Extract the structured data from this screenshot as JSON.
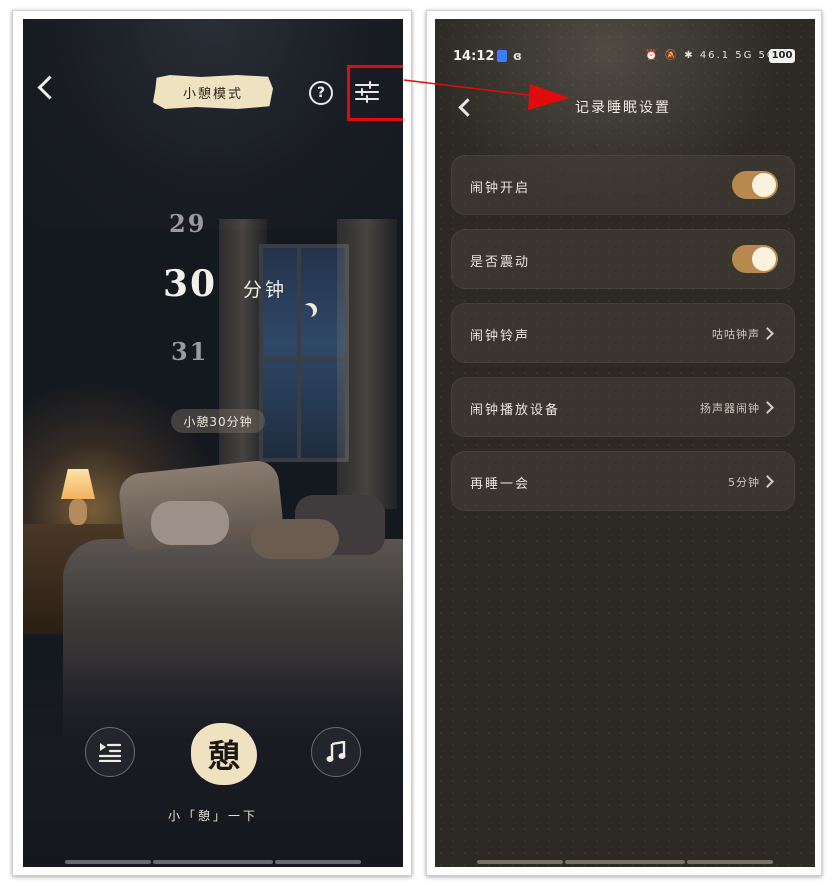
{
  "left_screen": {
    "mode_title": "小憩模式",
    "help_icon_glyph": "?",
    "picker": {
      "prev": "29",
      "current": "30",
      "next": "31",
      "unit": "分钟"
    },
    "hint_pill": "小憩30分钟",
    "main_button": {
      "glyph": "憩",
      "caption": "小「憩」一下"
    },
    "icons": [
      "back-icon",
      "help-icon",
      "settings-sliders-icon",
      "playlist-icon",
      "music-note-icon"
    ]
  },
  "right_screen": {
    "status_bar": {
      "time": "14:12",
      "app_glyph": "ɞ",
      "icons_text": "⏰ 🔕 ✱ 46.1 5G 5G ≋",
      "battery": "100"
    },
    "title": "记录睡眠设置",
    "rows": [
      {
        "label": "闹钟开启",
        "type": "toggle",
        "on": true
      },
      {
        "label": "是否震动",
        "type": "toggle",
        "on": true
      },
      {
        "label": "闹钟铃声",
        "type": "select",
        "value": "咕咕钟声"
      },
      {
        "label": "闹钟播放设备",
        "type": "select",
        "value": "扬声器闹钟"
      },
      {
        "label": "再睡一会",
        "type": "select",
        "value": "5分钟"
      }
    ]
  },
  "colors": {
    "highlight_red": "#e20b0b",
    "toggle_on": "#b8894f",
    "badge_paper": "#efe2c1"
  }
}
